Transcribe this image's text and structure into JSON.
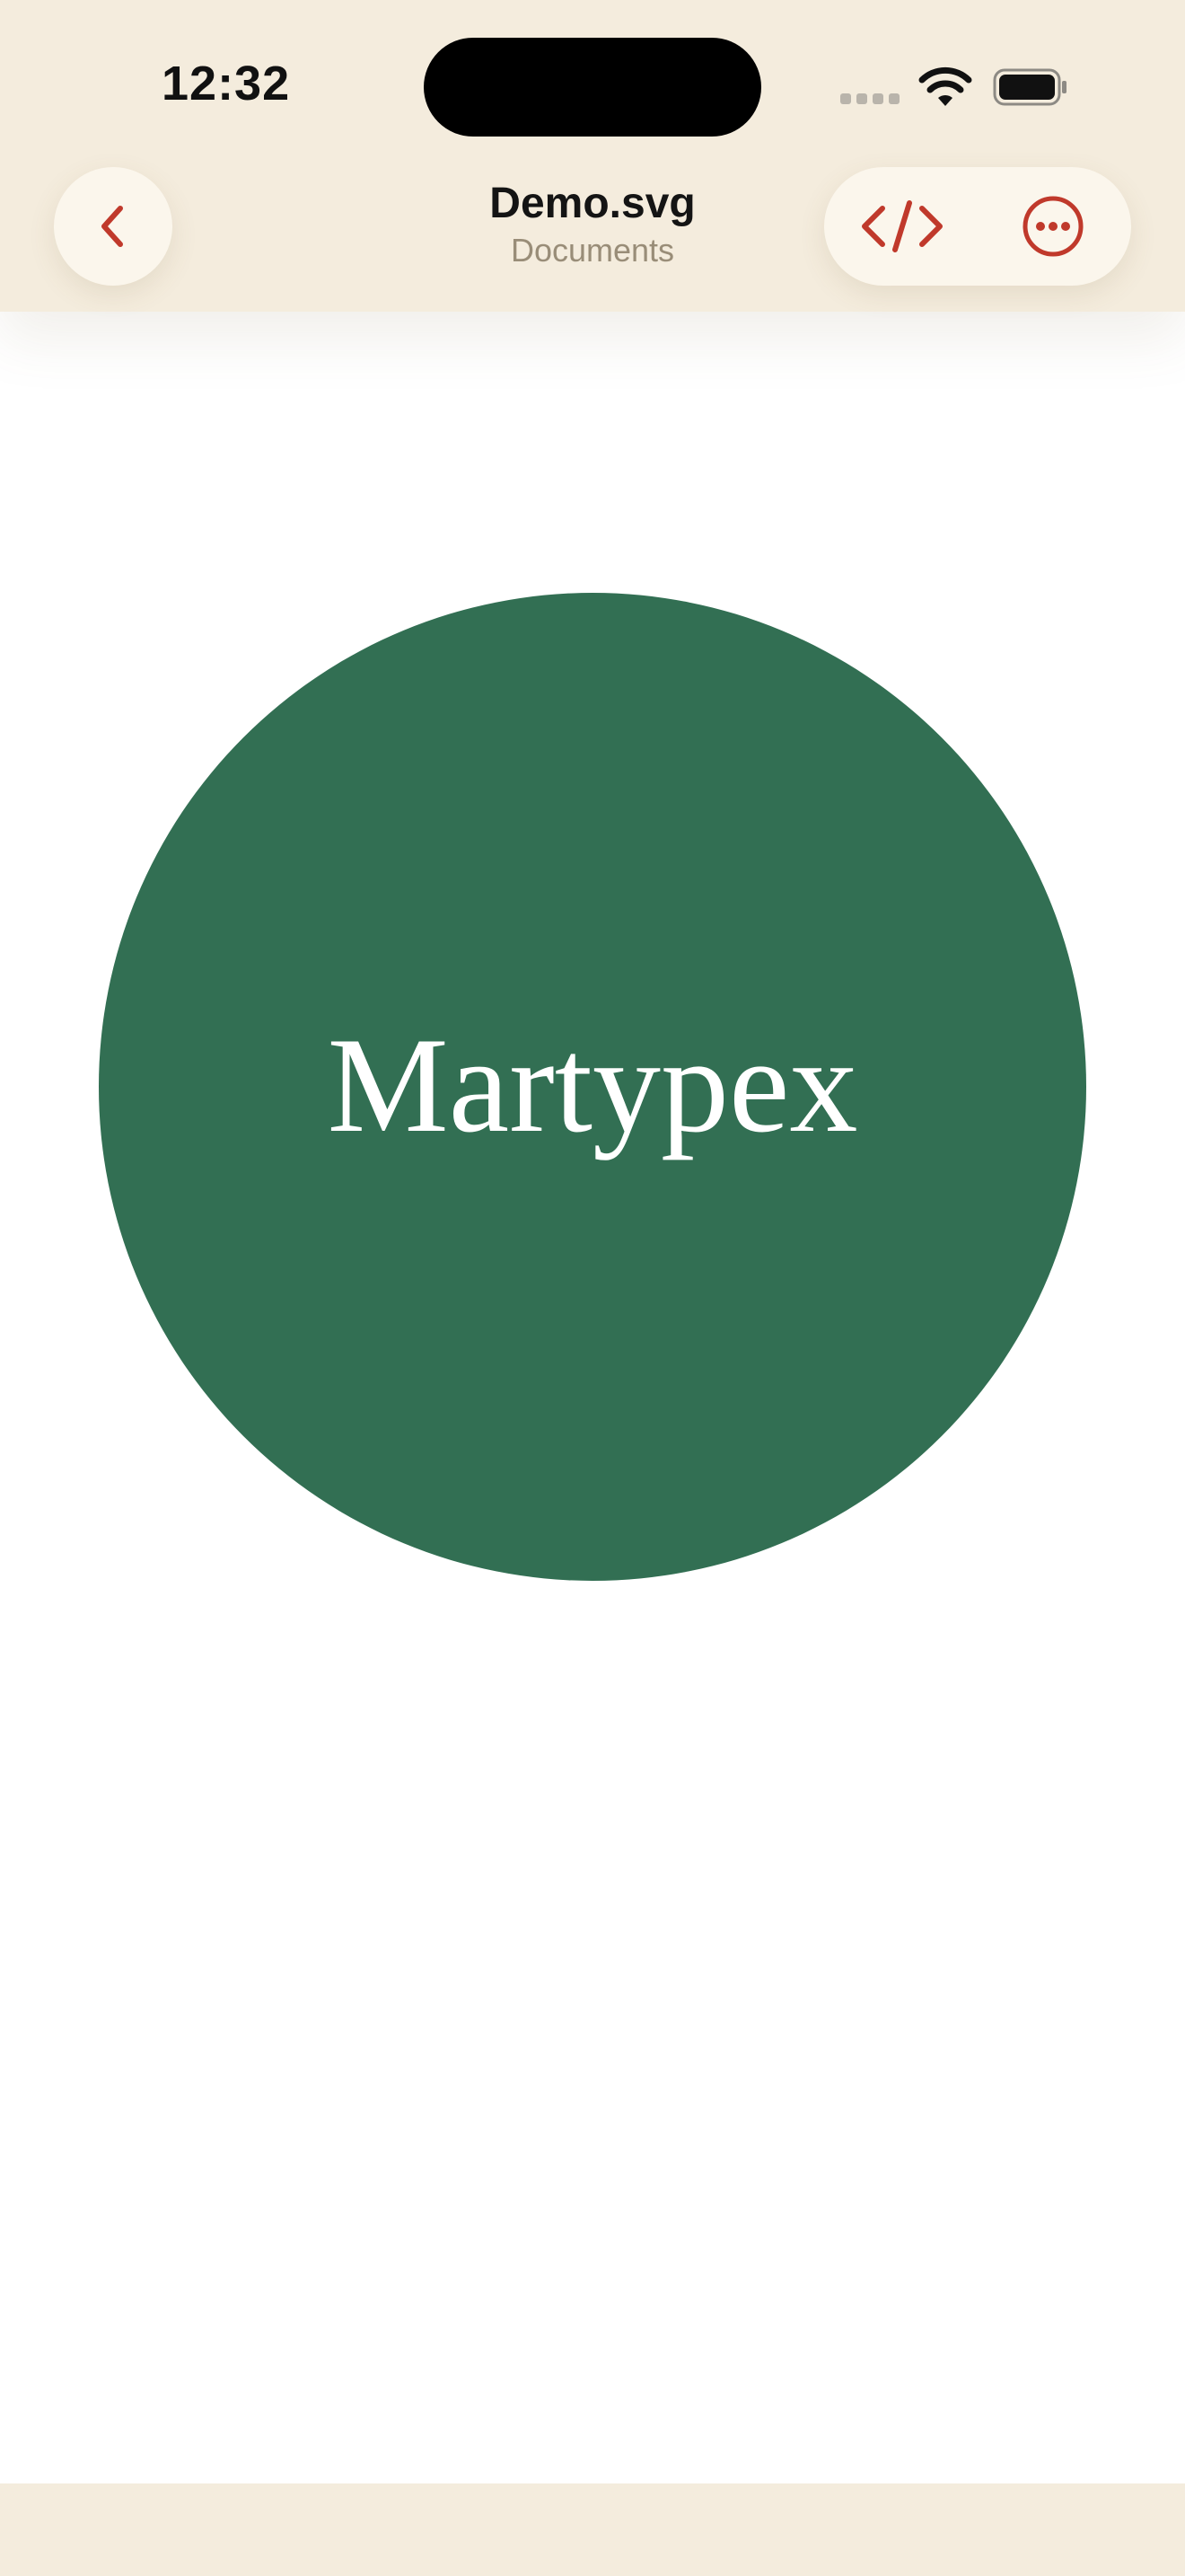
{
  "status_bar": {
    "time": "12:32"
  },
  "nav": {
    "title": "Demo.svg",
    "subtitle": "Documents",
    "back_icon": "chevron-left-icon",
    "code_icon": "code-icon",
    "more_icon": "ellipsis-circle-icon"
  },
  "document": {
    "circle_text": "Martypex",
    "circle_color": "#326F53",
    "text_color": "#FFFFFF"
  },
  "theme": {
    "chrome_background": "#F4ECDD",
    "button_background": "#FBF6EC",
    "accent": "#C0392B"
  }
}
